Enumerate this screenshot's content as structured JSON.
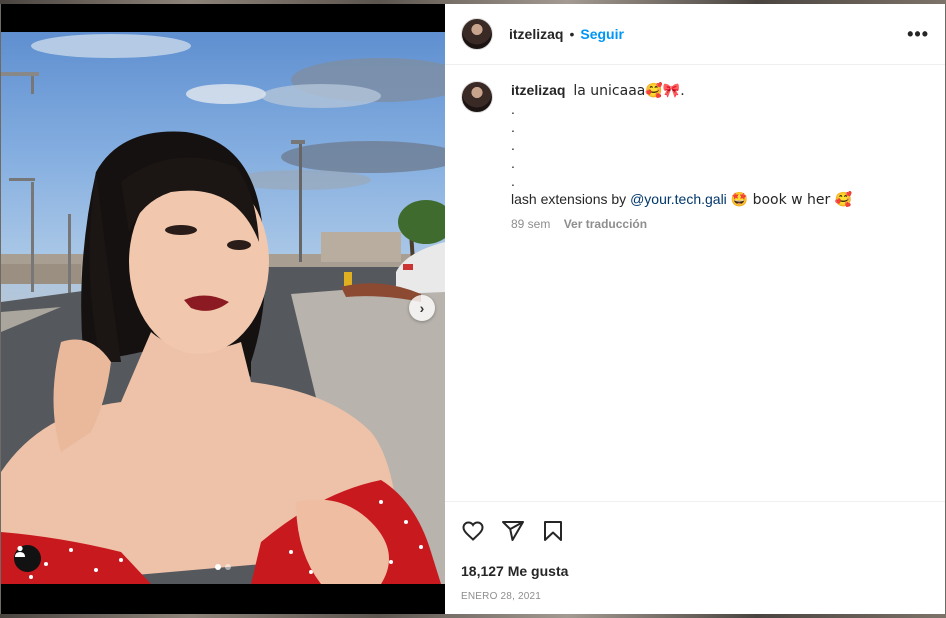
{
  "post": {
    "username": "itzelizaq",
    "separator": "•",
    "follow_label": "Seguir",
    "more_label": "•••",
    "caption": {
      "username": "itzelizaq",
      "first_line": "la unicaaa🥰🎀.",
      "dot_lines": [
        ".",
        ".",
        ".",
        ".",
        "."
      ],
      "lash_prefix": "lash extensions by",
      "mention": "@your.tech.gali",
      "lash_suffix": "🤩 book w her 🥰"
    },
    "meta": {
      "age": "89 sem",
      "translate_label": "Ver traducción"
    },
    "likes_label": "18,127 Me gusta",
    "date_label": "ENERO 28, 2021"
  },
  "media": {
    "next_label": "›",
    "slide_count": 2,
    "active_slide": 1
  },
  "icons": {
    "like": "heart-icon",
    "share": "send-icon",
    "save": "bookmark-icon",
    "tag": "user-tag-icon",
    "next": "chevron-right-icon"
  },
  "colors": {
    "follow": "#0095f6",
    "mention": "#00376b",
    "muted": "#8e8e8e",
    "text": "#262626"
  }
}
